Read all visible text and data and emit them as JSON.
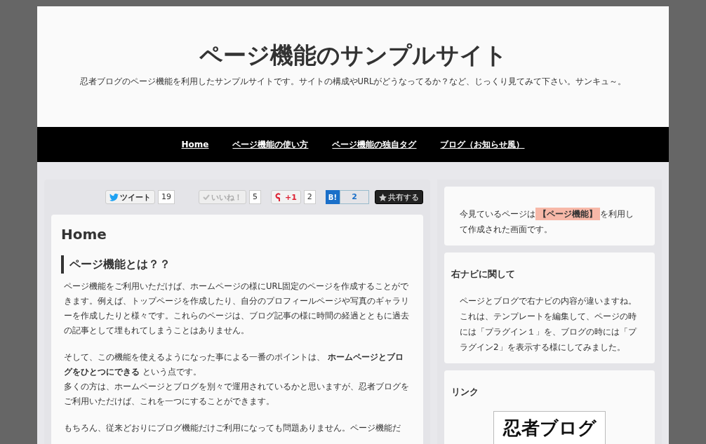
{
  "site": {
    "title": "ページ機能のサンプルサイト",
    "tagline": "忍者ブログのページ機能を利用したサンプルサイトです。サイトの構成やURLがどうなってるか？など、じっくり見てみて下さい。サンキュ～。"
  },
  "nav": [
    {
      "label": "Home"
    },
    {
      "label": "ページ機能の使い方"
    },
    {
      "label": "ページ機能の独自タグ"
    },
    {
      "label": "ブログ（お知らせ風）"
    }
  ],
  "social": [
    {
      "kind": "tweet",
      "label": "ツイート",
      "count": "19"
    },
    {
      "kind": "like",
      "label": "いいね！",
      "count": "5"
    },
    {
      "kind": "plusone",
      "label": "+1",
      "count": "2"
    },
    {
      "kind": "hatena",
      "label": "B!",
      "count": "2"
    },
    {
      "kind": "share",
      "label": "共有する"
    }
  ],
  "article": {
    "title": "Home",
    "heading": "ページ機能とは？？",
    "paragraphs": [
      "ページ機能をご利用いただけば、ホームページの様にURL固定のページを作成することができます。例えば、トップページを作成したり、自分のプロフィールページや写真のギャラリーを作成したりと様々です。これらのページは、ブログ記事の様に時間の経過とともに過去の記事として埋もれてしまうことはありません。",
      "そして、この機能を使えるようになった事による一番のポイントは、 **ホームページとブログをひとつにできる** という点です。",
      "多くの方は、ホームページとブログを別々で運用されているかと思いますが、忍者ブログをご利用いただけば、これを一つにすることができます。",
      "もちろん、従来どおりにブログ機能だけご利用になっても問題ありません。ページ機能だ"
    ]
  },
  "sidebar": {
    "intro": {
      "before": "今見ているページは",
      "highlight": "【ページ機能】",
      "after": "を利用して作成された画面です。"
    },
    "nav_box": {
      "title": "右ナビに関して",
      "text": "ページとブログで右ナビの内容が違いますね。これは、テンプレートを編集して、ページの時には「プラグイン１」を、ブログの時には「プラグイン2」を表示する様にしてみました。"
    },
    "links": {
      "title": "リンク",
      "banner": "忍者ブログ"
    }
  }
}
